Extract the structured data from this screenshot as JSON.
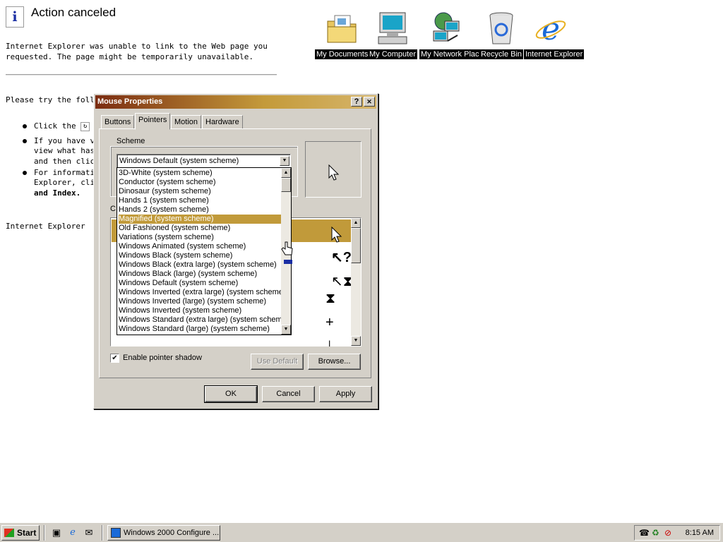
{
  "ie_page": {
    "title": "Action canceled",
    "para1_line1": "Internet Explorer was unable to link to the Web page you",
    "para1_line2": "requested. The page might be temporarily unavailable.",
    "try_text": "Please try the followir",
    "bullet1_text": "Click the",
    "bullet1_link": "Re",
    "bullet2_line1": "If you have vis",
    "bullet2_line2": "view what has",
    "bullet2_line3": "and then click",
    "bullet3_line1": "For informatior",
    "bullet3_line2": "Explorer, click",
    "bullet3_line3": "and Index.",
    "footer": "Internet Explorer"
  },
  "desktop_icons": [
    {
      "label": "My Documents",
      "icon": "folder-icon"
    },
    {
      "label": "My Computer",
      "icon": "computer-icon"
    },
    {
      "label": "My Network Places",
      "icon": "network-icon"
    },
    {
      "label": "Recycle Bin",
      "icon": "recycle-bin-icon"
    },
    {
      "label": "Internet Explorer",
      "icon": "ie-icon"
    }
  ],
  "dialog": {
    "title": "Mouse Properties",
    "help_btn": "?",
    "close_btn": "✕",
    "tabs": [
      "Buttons",
      "Pointers",
      "Motion",
      "Hardware"
    ],
    "active_tab": "Pointers",
    "scheme_label": "Scheme",
    "scheme_value": "Windows Default (system scheme)",
    "customize_label": "C",
    "scheme_options": [
      "3D-White (system scheme)",
      "Conductor (system scheme)",
      "Dinosaur (system scheme)",
      "Hands 1 (system scheme)",
      "Hands 2 (system scheme)",
      "Magnified (system scheme)",
      "Old Fashioned (system scheme)",
      "Variations (system scheme)",
      "Windows Animated (system scheme)",
      "Windows Black  (system scheme)",
      "Windows Black (extra large) (system scheme)",
      "Windows Black (large) (system scheme)",
      "Windows Default (system scheme)",
      "Windows Inverted (extra large) (system scheme)",
      "Windows Inverted (large) (system scheme)",
      "Windows Inverted (system scheme)",
      "Windows Standard (extra large) (system scheme)",
      "Windows Standard (large) (system scheme)"
    ],
    "selected_option": "Magnified (system scheme)",
    "shadow_label": "Enable pointer shadow",
    "shadow_checked": "✔",
    "use_default": "Use Default",
    "browse": "Browse...",
    "ok": "OK",
    "cancel": "Cancel",
    "apply": "Apply"
  },
  "taskbar": {
    "start": "Start",
    "task": "Windows 2000 Configure ...",
    "clock": "8:15 AM"
  },
  "colors": {
    "selection": "#c19a3a",
    "titlebar_start": "#7b2c11",
    "titlebar_end": "#d6b56a"
  }
}
